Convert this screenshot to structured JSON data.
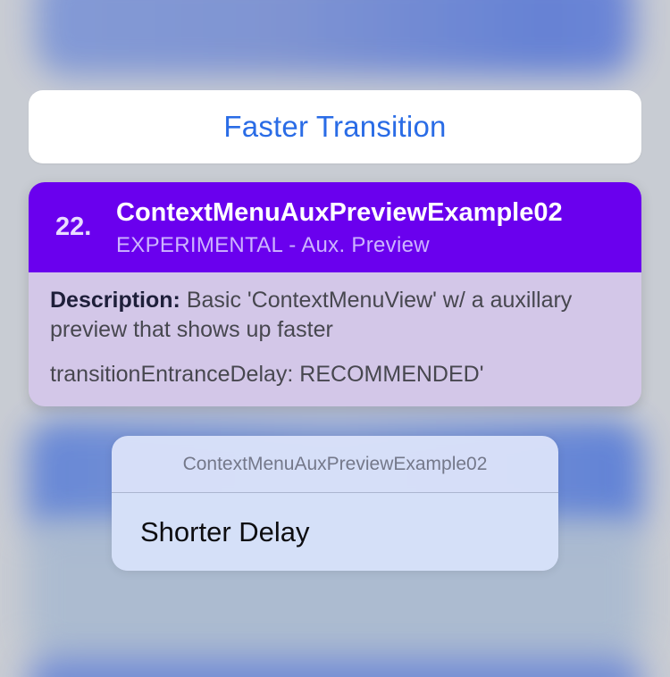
{
  "action_pill": {
    "label": "Faster Transition"
  },
  "preview_card": {
    "number": "22.",
    "title": "ContextMenuAuxPreviewExample02",
    "subtitle": "EXPERIMENTAL - Aux. Preview",
    "description_label": "Description:",
    "description_text": "Basic 'ContextMenuView' w/ a auxillary preview that shows up faster",
    "description_extra": "transitionEntranceDelay: RECOMMENDED'"
  },
  "context_menu": {
    "title": "ContextMenuAuxPreviewExample02",
    "items": [
      {
        "label": "Shorter Delay"
      }
    ]
  },
  "colors": {
    "accent_blue": "#2a6ce6",
    "header_purple": "#6a00ee",
    "body_lavender": "#d3c7e8",
    "menu_background": "#dbe3fa"
  }
}
